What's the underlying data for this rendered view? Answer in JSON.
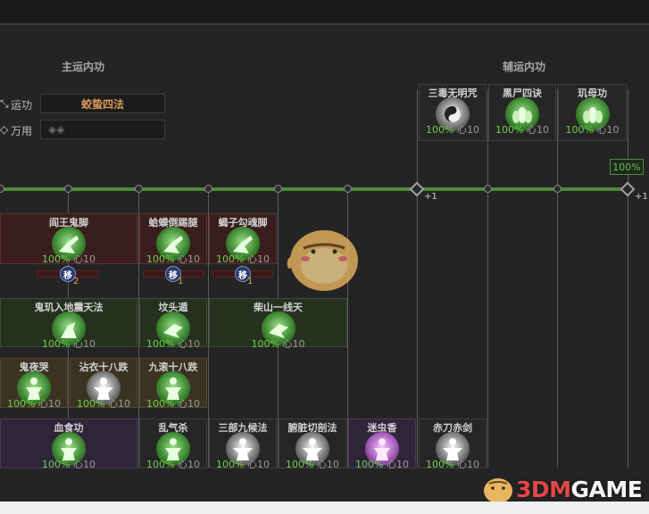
{
  "main_section": {
    "title": "主运内功"
  },
  "aux_section": {
    "title": "辅运内功"
  },
  "fields": {
    "run_label": "运功",
    "run_value": "蛟蛰四法",
    "universal_label": "万用",
    "universal_value": "◈◈"
  },
  "track": {
    "progress_pct": "100%",
    "plus_a": "+1",
    "plus_b": "+1"
  },
  "aux_cards": [
    {
      "name": "三毒无明咒",
      "pct": "100%",
      "xin": "心10",
      "icon": "yinyang-icon"
    },
    {
      "name": "黑尸四诀",
      "pct": "100%",
      "xin": "心10",
      "icon": "lotus-icon"
    },
    {
      "name": "玑母功",
      "pct": "100%",
      "xin": "心10",
      "icon": "lotus-icon"
    }
  ],
  "row1": [
    {
      "name": "阎王鬼脚",
      "pct": "100%",
      "xin": "心10",
      "move": "移",
      "move_count": "2"
    },
    {
      "name": "蛤蟆倒踢腿",
      "pct": "100%",
      "xin": "心10",
      "move": "移",
      "move_count": "1"
    },
    {
      "name": "蝎子勾魂脚",
      "pct": "100%",
      "xin": "心10",
      "move": "移",
      "move_count": "1"
    }
  ],
  "row2": [
    {
      "name": "鬼玑入地震天法",
      "pct": "100%",
      "xin": "心10"
    },
    {
      "name": "坟头遁",
      "pct": "100%",
      "xin": "心10"
    },
    {
      "name": "柴山一线天",
      "pct": "100%",
      "xin": "心10"
    }
  ],
  "row3": [
    {
      "name": "鬼夜哭",
      "pct": "100%",
      "xin": "心10"
    },
    {
      "name": "沾衣十八跌",
      "pct": "100%",
      "xin": "心10"
    },
    {
      "name": "九滚十八跌",
      "pct": "100%",
      "xin": "心10"
    }
  ],
  "row4": [
    {
      "name": "血食功",
      "pct": "100%",
      "xin": "心10"
    },
    {
      "name": "乱气杀",
      "pct": "100%",
      "xin": "心10"
    },
    {
      "name": "三部九候法",
      "pct": "100%",
      "xin": "心10"
    },
    {
      "name": "腑脏切剖法",
      "pct": "100%",
      "xin": "心10"
    },
    {
      "name": "迷虫香",
      "pct": "100%",
      "xin": "心10"
    },
    {
      "name": "赤刀赤剑",
      "pct": "100%",
      "xin": "心10"
    }
  ],
  "watermark": {
    "prefix": "3DM",
    "suffix": "GAME"
  },
  "colors": {
    "accent_green": "#6fd04f",
    "track_green": "#4e8a3e",
    "name_orange": "#d99a5a"
  }
}
